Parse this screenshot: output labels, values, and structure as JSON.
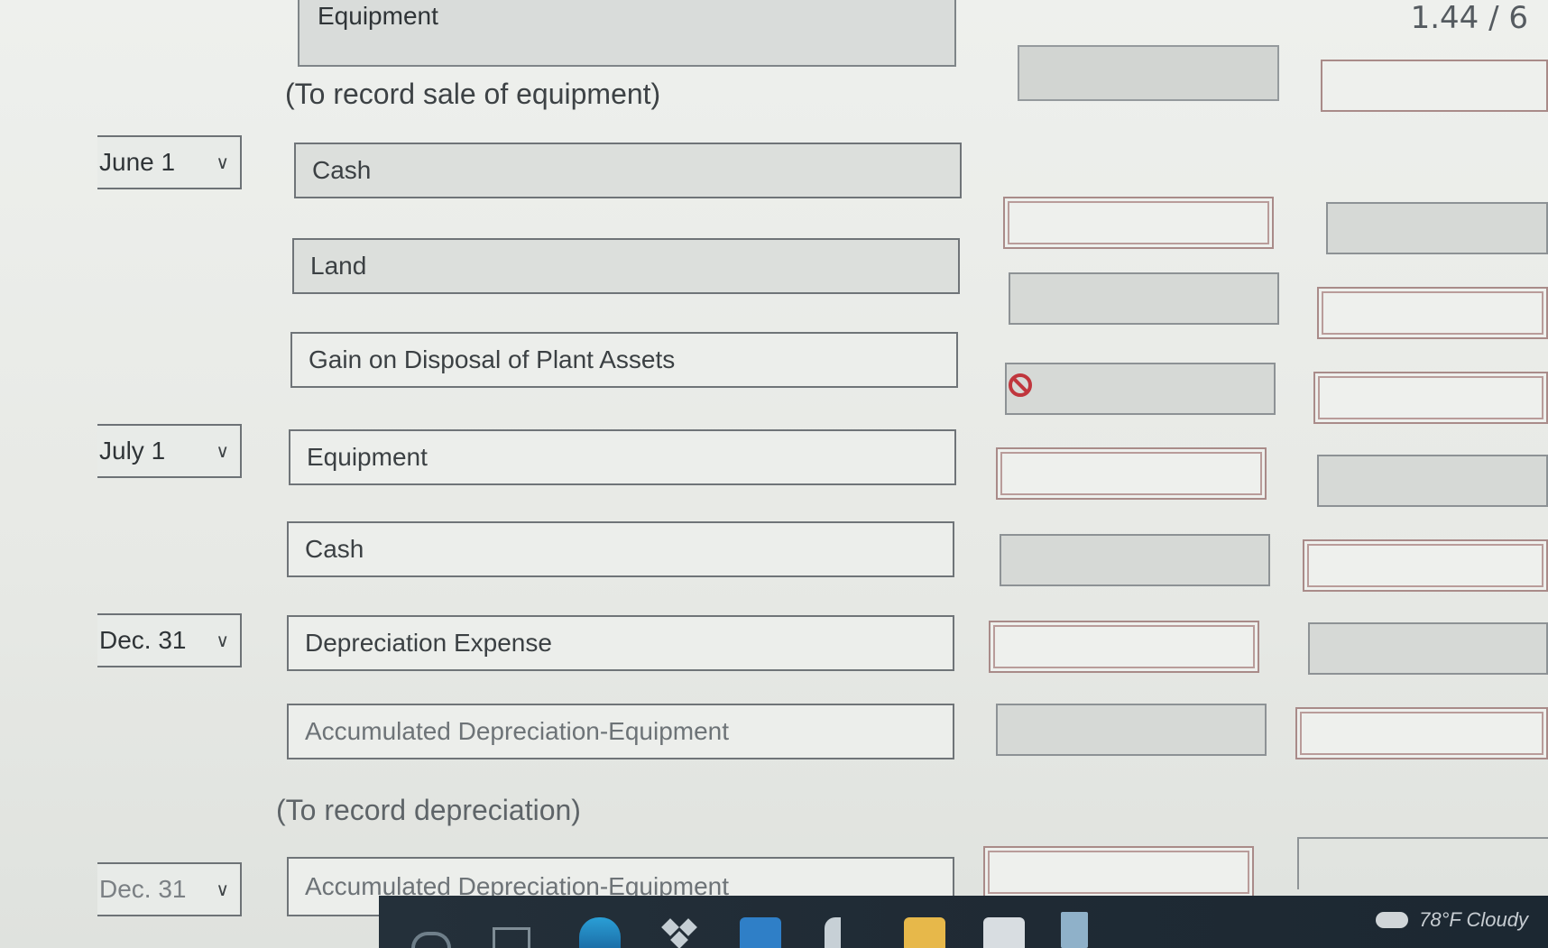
{
  "header": {
    "top_label": "Equipment",
    "right_value": "1.44 / 6"
  },
  "notes": {
    "sale": "(To record sale of equipment)",
    "depreciation": "(To record depreciation)"
  },
  "rows": [
    {
      "date": "June 1",
      "account": "Cash"
    },
    {
      "date": "",
      "account": "Land"
    },
    {
      "date": "",
      "account": "Gain on Disposal of Plant Assets"
    },
    {
      "date": "July 1",
      "account": "Equipment"
    },
    {
      "date": "",
      "account": "Cash"
    },
    {
      "date": "Dec. 31",
      "account": "Depreciation Expense"
    },
    {
      "date": "",
      "account": "Accumulated Depreciation-Equipment"
    },
    {
      "date": "Dec. 31",
      "account": "Accumulated Depreciation-Equipment"
    }
  ],
  "taskbar": {
    "weather_text": "78°F  Cloudy",
    "weather_icon": "cloud-icon"
  },
  "colors": {
    "blocked_icon": "#c0363d",
    "taskbar_bg": "#1f2a34"
  }
}
